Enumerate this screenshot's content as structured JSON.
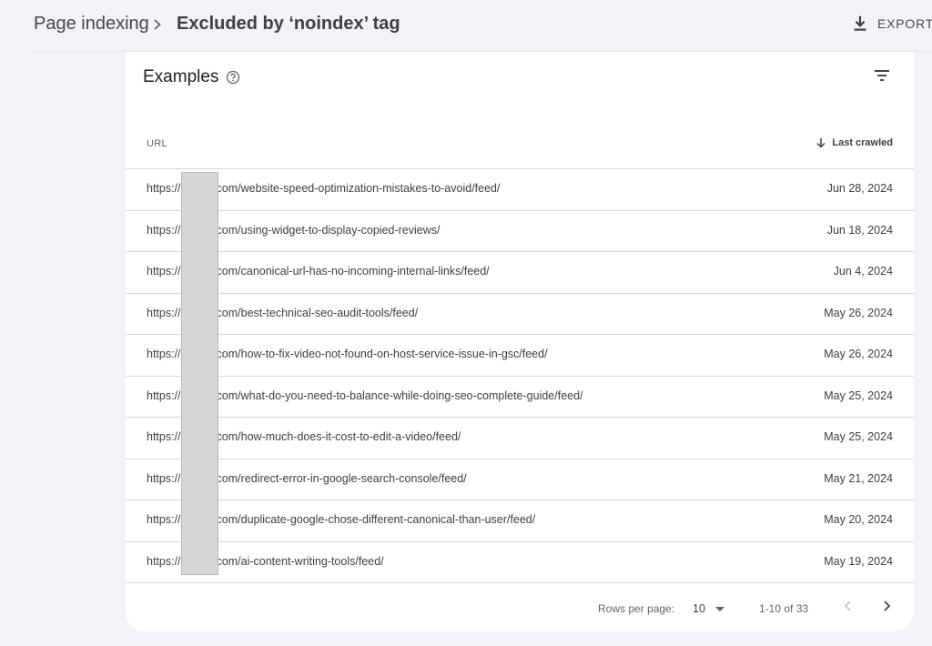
{
  "header": {
    "breadcrumb_root": "Page indexing",
    "breadcrumb_current": "Excluded by ‘noindex’ tag",
    "export_label": "EXPORT"
  },
  "card": {
    "title": "Examples",
    "columns": {
      "url": "URL",
      "last_crawled": "Last crawled"
    },
    "rows": [
      {
        "url_prefix": "https://",
        "url_suffix": "com/website-speed-optimization-mistakes-to-avoid/feed/",
        "date": "Jun 28, 2024"
      },
      {
        "url_prefix": "https://",
        "url_suffix": "com/using-widget-to-display-copied-reviews/",
        "date": "Jun 18, 2024"
      },
      {
        "url_prefix": "https://",
        "url_suffix": "com/canonical-url-has-no-incoming-internal-links/feed/",
        "date": "Jun 4, 2024"
      },
      {
        "url_prefix": "https://",
        "url_suffix": "com/best-technical-seo-audit-tools/feed/",
        "date": "May 26, 2024"
      },
      {
        "url_prefix": "https://",
        "url_suffix": "com/how-to-fix-video-not-found-on-host-service-issue-in-gsc/feed/",
        "date": "May 26, 2024"
      },
      {
        "url_prefix": "https://",
        "url_suffix": "com/what-do-you-need-to-balance-while-doing-seo-complete-guide/feed/",
        "date": "May 25, 2024"
      },
      {
        "url_prefix": "https://",
        "url_suffix": "com/how-much-does-it-cost-to-edit-a-video/feed/",
        "date": "May 25, 2024"
      },
      {
        "url_prefix": "https://",
        "url_suffix": "com/redirect-error-in-google-search-console/feed/",
        "date": "May 21, 2024"
      },
      {
        "url_prefix": "https://",
        "url_suffix": "com/duplicate-google-chose-different-canonical-than-user/feed/",
        "date": "May 20, 2024"
      },
      {
        "url_prefix": "https://",
        "url_suffix": "com/ai-content-writing-tools/feed/",
        "date": "May 19, 2024"
      }
    ]
  },
  "pagination": {
    "rows_per_page_label": "Rows per page:",
    "rows_per_page_value": "10",
    "range_label": "1-10 of 33"
  },
  "colors": {
    "background": "#f1f3f8",
    "card": "#ffffff",
    "text": "#1f1f1f"
  }
}
